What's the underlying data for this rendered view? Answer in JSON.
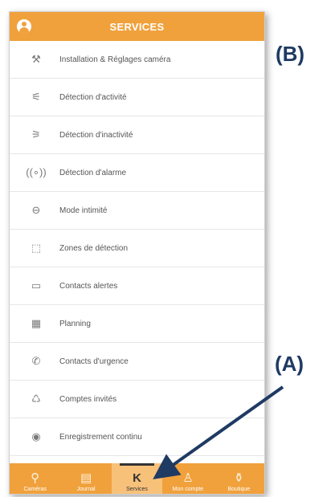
{
  "header": {
    "title": "SERVICES",
    "user_icon": "user-icon"
  },
  "services": [
    {
      "label": "Installation & Réglages caméra",
      "icon": "tools-icon",
      "glyph": "⚒"
    },
    {
      "label": "Détection d'activité",
      "icon": "activity-icon",
      "glyph": "⚟"
    },
    {
      "label": "Détection d'inactivité",
      "icon": "inactivity-icon",
      "glyph": "⚞"
    },
    {
      "label": "Détection d'alarme",
      "icon": "alarm-icon",
      "glyph": "((∘))"
    },
    {
      "label": "Mode intimité",
      "icon": "privacy-icon",
      "glyph": "⊖"
    },
    {
      "label": "Zones de détection",
      "icon": "zone-icon",
      "glyph": "⬚"
    },
    {
      "label": "Contacts alertes",
      "icon": "contacts-alert-icon",
      "glyph": "▭"
    },
    {
      "label": "Planning",
      "icon": "calendar-icon",
      "glyph": "▦"
    },
    {
      "label": "Contacts d'urgence",
      "icon": "emergency-icon",
      "glyph": "✆"
    },
    {
      "label": "Comptes invités",
      "icon": "guests-icon",
      "glyph": "♺"
    },
    {
      "label": "Enregistrement continu",
      "icon": "record-icon",
      "glyph": "◉"
    }
  ],
  "tabs": [
    {
      "label": "Caméras",
      "icon": "camera-icon",
      "glyph": "⚲",
      "active": false
    },
    {
      "label": "Journal",
      "icon": "journal-icon",
      "glyph": "▤",
      "active": false
    },
    {
      "label": "Services",
      "icon": "services-logo-icon",
      "glyph": "K",
      "active": true
    },
    {
      "label": "Mon compte",
      "icon": "account-icon",
      "glyph": "♙",
      "active": false
    },
    {
      "label": "Boutique",
      "icon": "shop-icon",
      "glyph": "⚱",
      "active": false
    }
  ],
  "annotations": {
    "b": "(B)",
    "a": "(A)"
  },
  "colors": {
    "accent": "#f0a13c",
    "callout": "#1f3a63"
  }
}
